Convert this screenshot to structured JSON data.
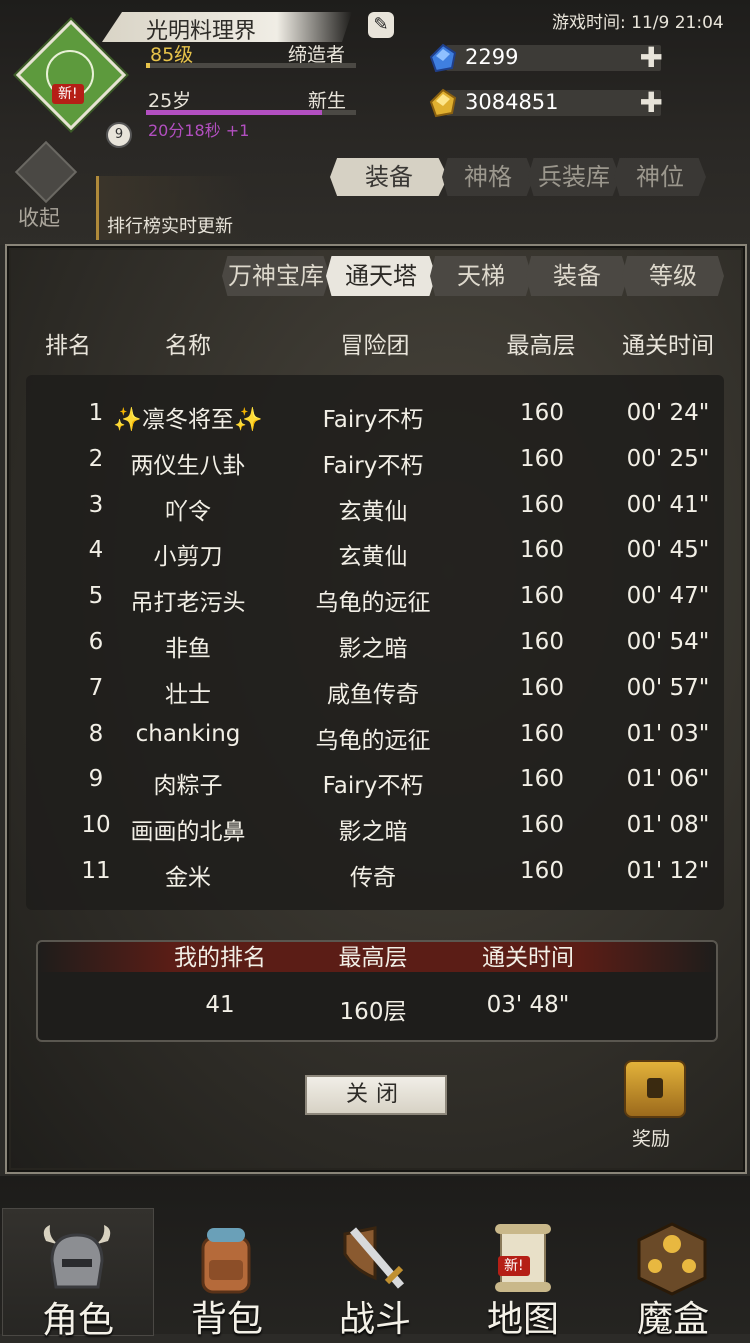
{
  "header": {
    "new_badge": "新!",
    "avatar_level": "9",
    "player_name": "光明料理界",
    "level": "85级",
    "title": "缔造者",
    "age": "25岁",
    "life_stage": "新生",
    "timer": "20分18秒 +1",
    "game_time": "游戏时间: 11/9 21:04",
    "gems": "2299",
    "gold": "3084851",
    "collapse_label": "收起",
    "rank_note": "排行榜实时更新",
    "tabs": [
      "装备",
      "神格",
      "兵装库",
      "神位"
    ],
    "colors": {
      "level": "#e7c34a",
      "timer": "#b24fc0"
    }
  },
  "ranking": {
    "tabs": [
      "万神宝库",
      "通天塔",
      "天梯",
      "装备",
      "等级"
    ],
    "active_tab": "通天塔",
    "columns": [
      "排名",
      "名称",
      "冒险团",
      "最高层",
      "通关时间"
    ],
    "rows": [
      {
        "rank": "1",
        "name": "✨凛冬将至✨",
        "guild": "Fairy不朽",
        "floor": "160",
        "time": "00' 24\""
      },
      {
        "rank": "2",
        "name": "两仪生八卦",
        "guild": "Fairy不朽",
        "floor": "160",
        "time": "00' 25\""
      },
      {
        "rank": "3",
        "name": "吖令",
        "guild": "玄黄仙",
        "floor": "160",
        "time": "00' 41\""
      },
      {
        "rank": "4",
        "name": "小剪刀",
        "guild": "玄黄仙",
        "floor": "160",
        "time": "00' 45\""
      },
      {
        "rank": "5",
        "name": "吊打老污头",
        "guild": "乌龟的远征",
        "floor": "160",
        "time": "00' 47\""
      },
      {
        "rank": "6",
        "name": "非鱼",
        "guild": "影之暗",
        "floor": "160",
        "time": "00' 54\""
      },
      {
        "rank": "7",
        "name": "壮士",
        "guild": "咸鱼传奇",
        "floor": "160",
        "time": "00' 57\""
      },
      {
        "rank": "8",
        "name": "chanking",
        "guild": "乌龟的远征",
        "floor": "160",
        "time": "01' 03\""
      },
      {
        "rank": "9",
        "name": "肉粽子",
        "guild": "Fairy不朽",
        "floor": "160",
        "time": "01' 06\""
      },
      {
        "rank": "10",
        "name": "画画的北鼻",
        "guild": "影之暗",
        "floor": "160",
        "time": "01' 08\""
      },
      {
        "rank": "11",
        "name": "金米",
        "guild": "传奇",
        "floor": "160",
        "time": "01' 12\""
      }
    ],
    "my": {
      "headers": [
        "我的排名",
        "最高层",
        "通关时间"
      ],
      "rank": "41",
      "floor": "160层",
      "time": "03' 48\""
    },
    "close_label": "关闭",
    "reward_label": "奖励"
  },
  "bottom_nav": {
    "items": [
      {
        "label": "角色",
        "icon": "helmet-icon"
      },
      {
        "label": "背包",
        "icon": "backpack-icon"
      },
      {
        "label": "战斗",
        "icon": "sword-shield-icon"
      },
      {
        "label": "地图",
        "icon": "scroll-map-icon",
        "badge": "新!"
      },
      {
        "label": "魔盒",
        "icon": "magic-box-icon"
      }
    ]
  }
}
